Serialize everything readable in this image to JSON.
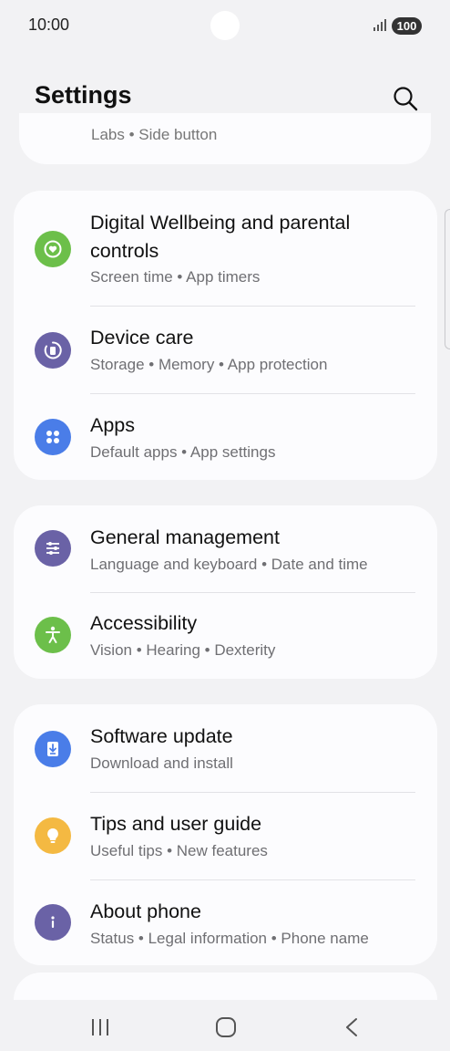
{
  "status_bar": {
    "time": "10:00",
    "battery": "100",
    "icons": [
      "signal-icon",
      "battery-icon"
    ]
  },
  "header": {
    "title": "Settings",
    "search_icon": "search-icon"
  },
  "partial_card_top": {
    "text": "Labs  •  Side button"
  },
  "cards": [
    {
      "items": [
        {
          "title_line1": "Digital Wellbeing and parental",
          "title_line2": "controls",
          "subtitle": "Screen time  •  App timers",
          "icon": "digital-wellbeing-icon",
          "icon_color": "#6cbf4a"
        },
        {
          "title": "Device care",
          "subtitle": "Storage  •  Memory  •  App protection",
          "icon": "device-care-icon",
          "icon_color": "#6a62a6"
        },
        {
          "title": "Apps",
          "subtitle": "Default apps  •  App settings",
          "icon": "apps-icon",
          "icon_color": "#4a7de8"
        }
      ]
    },
    {
      "items": [
        {
          "title": "General management",
          "subtitle": "Language and keyboard  •  Date and time",
          "icon": "general-management-icon",
          "icon_color": "#6a62a6"
        },
        {
          "title": "Accessibility",
          "subtitle": "Vision  •  Hearing  •  Dexterity",
          "icon": "accessibility-icon",
          "icon_color": "#6cbf4a"
        }
      ]
    },
    {
      "items": [
        {
          "title": "Software update",
          "subtitle": "Download and install",
          "icon": "software-update-icon",
          "icon_color": "#4a7de8"
        },
        {
          "title": "Tips and user guide",
          "subtitle": "Useful tips  •  New features",
          "icon": "tips-icon",
          "icon_color": "#f4b942"
        },
        {
          "title": "About phone",
          "subtitle": "Status  •  Legal information  •  Phone name",
          "icon": "about-phone-icon",
          "icon_color": "#6a62a6"
        }
      ]
    }
  ],
  "nav_bar": {
    "buttons": [
      "recents-button",
      "home-button",
      "back-button"
    ]
  }
}
